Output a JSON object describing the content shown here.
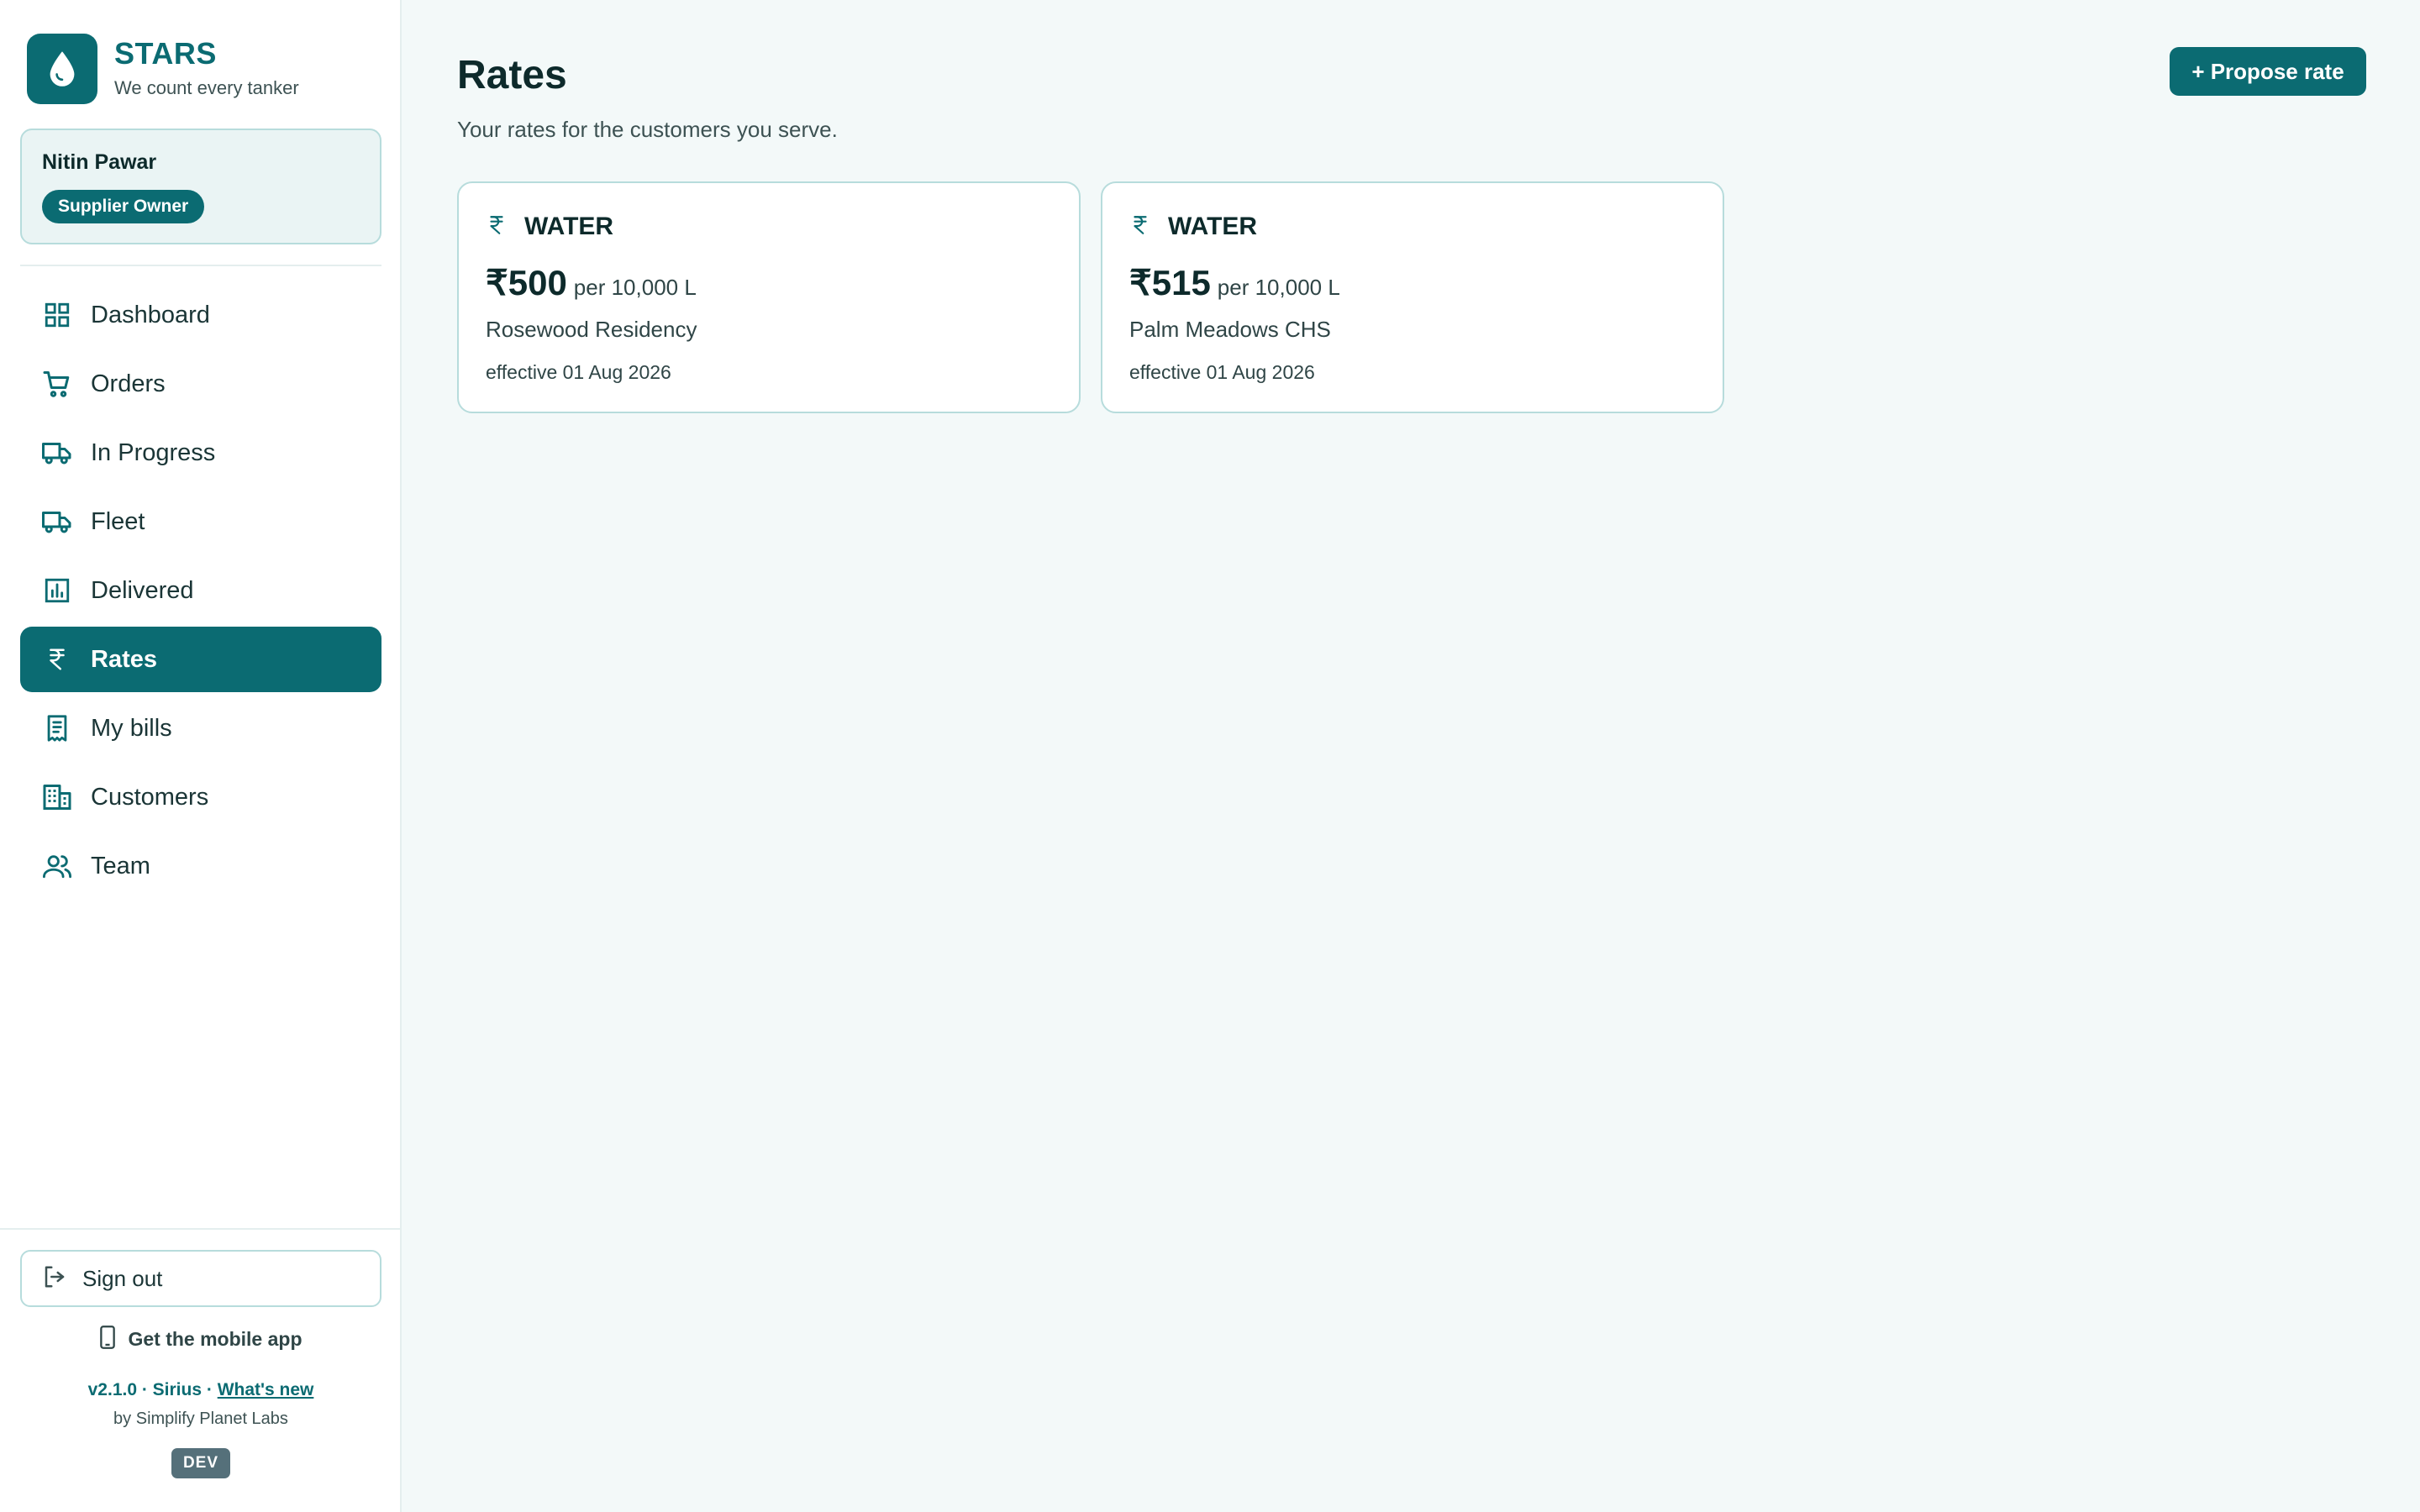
{
  "brand": {
    "name": "STARS",
    "tagline": "We count every tanker",
    "accent_color": "#0b6b72"
  },
  "user": {
    "name": "Nitin Pawar",
    "role": "Supplier Owner"
  },
  "nav": {
    "active": "Rates",
    "items": [
      {
        "label": "Dashboard",
        "icon": "dashboard-icon"
      },
      {
        "label": "Orders",
        "icon": "cart-icon"
      },
      {
        "label": "In Progress",
        "icon": "truck-icon"
      },
      {
        "label": "Fleet",
        "icon": "truck-icon"
      },
      {
        "label": "Delivered",
        "icon": "bar-chart-icon"
      },
      {
        "label": "Rates",
        "icon": "rupee-icon"
      },
      {
        "label": "My bills",
        "icon": "receipt-icon"
      },
      {
        "label": "Customers",
        "icon": "building-icon"
      },
      {
        "label": "Team",
        "icon": "people-icon"
      }
    ]
  },
  "footer": {
    "sign_out": "Sign out",
    "mobile_app": "Get the mobile app",
    "version": "v2.1.0 · Sirius · ",
    "whats_new": "What's new",
    "byline": "by Simplify Planet Labs",
    "env": "DEV"
  },
  "page": {
    "title": "Rates",
    "subtitle": "Your rates for the customers you serve.",
    "propose_button": "+ Propose rate"
  },
  "rates": [
    {
      "type": "WATER",
      "price": "₹500",
      "unit": "per 10,000 L",
      "customer": "Rosewood Residency",
      "effective": "effective 01 Aug 2026"
    },
    {
      "type": "WATER",
      "price": "₹515",
      "unit": "per 10,000 L",
      "customer": "Palm Meadows CHS",
      "effective": "effective 01 Aug 2026"
    }
  ]
}
